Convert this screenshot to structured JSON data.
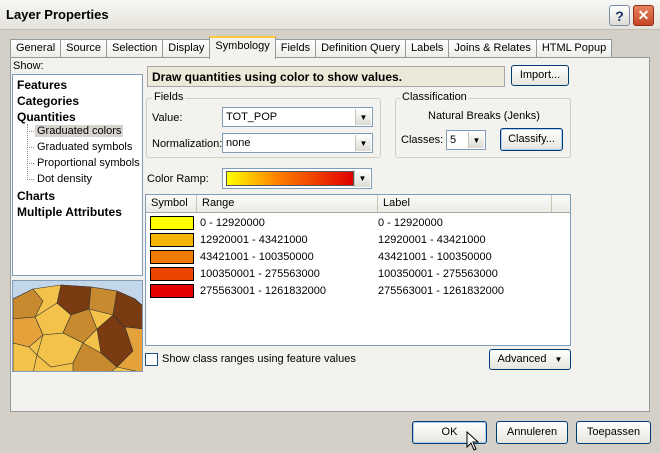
{
  "window": {
    "title": "Layer Properties",
    "help_glyph": "?",
    "close_glyph": "✕"
  },
  "tabs": [
    {
      "label": "General"
    },
    {
      "label": "Source"
    },
    {
      "label": "Selection"
    },
    {
      "label": "Display"
    },
    {
      "label": "Symbology",
      "active": true
    },
    {
      "label": "Fields"
    },
    {
      "label": "Definition Query"
    },
    {
      "label": "Labels"
    },
    {
      "label": "Joins & Relates"
    },
    {
      "label": "HTML Popup"
    }
  ],
  "show": {
    "label": "Show:",
    "items": [
      {
        "label": "Features"
      },
      {
        "label": "Categories"
      },
      {
        "label": "Quantities"
      },
      {
        "label": "Graduated colors",
        "selected": true
      },
      {
        "label": "Graduated symbols"
      },
      {
        "label": "Proportional symbols"
      },
      {
        "label": "Dot density"
      },
      {
        "label": "Charts"
      },
      {
        "label": "Multiple Attributes"
      }
    ]
  },
  "description": "Draw quantities using color to show values.",
  "import_button": "Import...",
  "fields": {
    "title": "Fields",
    "value_label": "Value:",
    "value": "TOT_POP",
    "normalization_label": "Normalization:",
    "normalization": "none"
  },
  "classification": {
    "title": "Classification",
    "method": "Natural Breaks (Jenks)",
    "classes_label": "Classes:",
    "classes": "5",
    "classify_button": "Classify..."
  },
  "color_ramp": {
    "label": "Color Ramp:",
    "start_color": "#ffff00",
    "end_color": "#e00000"
  },
  "table": {
    "headers": [
      "Symbol",
      "Range",
      "Label"
    ],
    "rows": [
      {
        "color": "#ffff00",
        "range": "0 - 12920000",
        "label": "0 - 12920000"
      },
      {
        "color": "#f2b400",
        "range": "12920001 - 43421000",
        "label": "12920001 - 43421000"
      },
      {
        "color": "#ef7a00",
        "range": "43421001 - 100350000",
        "label": "43421001 - 100350000"
      },
      {
        "color": "#ed4400",
        "range": "100350001 - 275563000",
        "label": "100350001 - 275563000"
      },
      {
        "color": "#e60000",
        "range": "275563001 - 1261832000",
        "label": "275563001 - 1261832000"
      }
    ]
  },
  "show_ranges_checkbox": {
    "label": "Show class ranges using feature values",
    "checked": false
  },
  "advanced_button": "Advanced",
  "footer": {
    "ok": "OK",
    "cancel": "Annuleren",
    "apply": "Toepassen"
  }
}
